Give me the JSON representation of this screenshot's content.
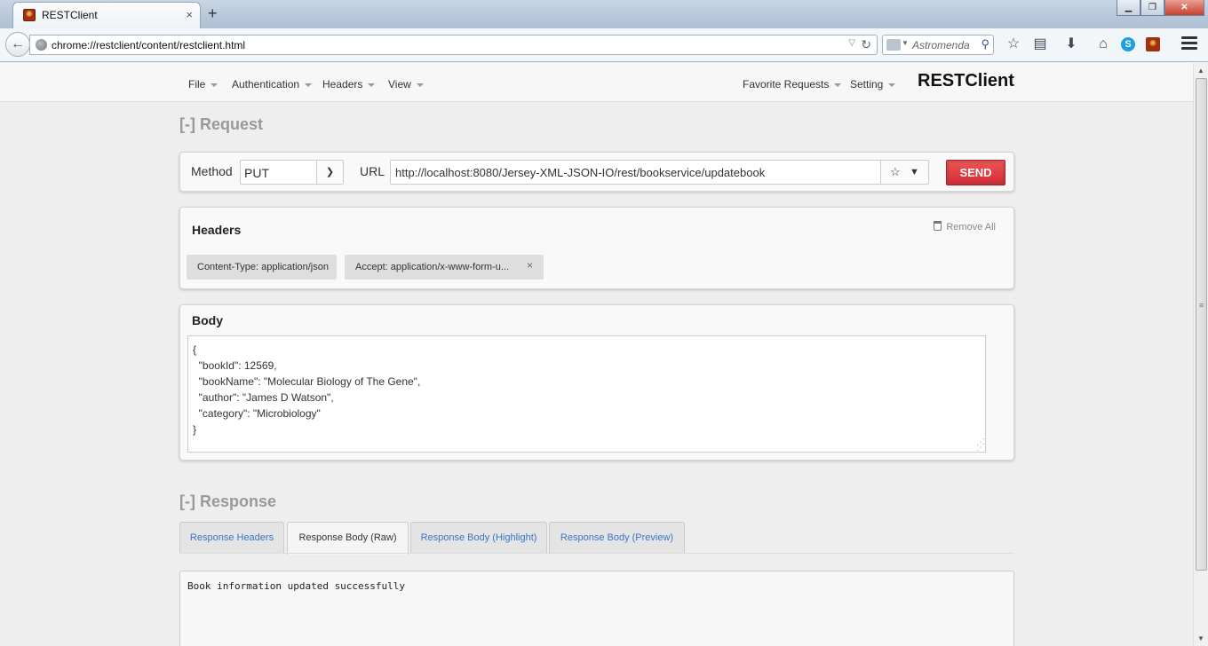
{
  "browser": {
    "tab_title": "RESTClient",
    "tab_close": "×",
    "new_tab": "+",
    "win_minimize": "▁",
    "win_restore": "❐",
    "win_close": "✕",
    "url": "chrome://restclient/content/restclient.html",
    "search_placeholder": "Astromenda",
    "icons": [
      "back-arrow-icon",
      "globe-icon",
      "dropdown-icon",
      "reload-icon",
      "search-engine-icon",
      "search-go-icon",
      "bookmark-star-icon",
      "reading-list-icon",
      "download-icon",
      "home-icon",
      "skype-icon",
      "restclient-addon-icon",
      "hamburger-menu-icon"
    ]
  },
  "app": {
    "brand": "RESTClient",
    "menu": {
      "file": "File",
      "authentication": "Authentication",
      "headers": "Headers",
      "view": "View",
      "favorite_requests": "Favorite Requests",
      "setting": "Setting"
    }
  },
  "request": {
    "section_title": "[-] Request",
    "method_label": "Method",
    "method_value": "PUT",
    "url_label": "URL",
    "url_value": "http://localhost:8080/Jersey-XML-JSON-IO/rest/bookservice/updatebook",
    "send_label": "SEND",
    "headers": {
      "title": "Headers",
      "remove_all_label": "Remove All",
      "items": [
        {
          "label": "Content-Type: application/json"
        },
        {
          "label": "Accept: application/x-www-form-u..."
        }
      ]
    },
    "body": {
      "title": "Body",
      "lines": [
        "{",
        "  \"bookId\": 12569,",
        "  \"bookName\": \"Molecular Biology of The Gene\",",
        "  \"author\": \"James D Watson\",",
        "  \"category\": \"Microbiology\"",
        "}"
      ]
    }
  },
  "response": {
    "section_title": "[-] Response",
    "tabs": [
      {
        "label": "Response Headers",
        "active": false
      },
      {
        "label": "Response Body (Raw)",
        "active": true
      },
      {
        "label": "Response Body (Highlight)",
        "active": false
      },
      {
        "label": "Response Body (Preview)",
        "active": false
      }
    ],
    "body_text": "Book information updated successfully"
  },
  "colors": {
    "send_button": "#dd3a3a",
    "tab_link": "#3a74c9",
    "section_title": "#999999"
  }
}
